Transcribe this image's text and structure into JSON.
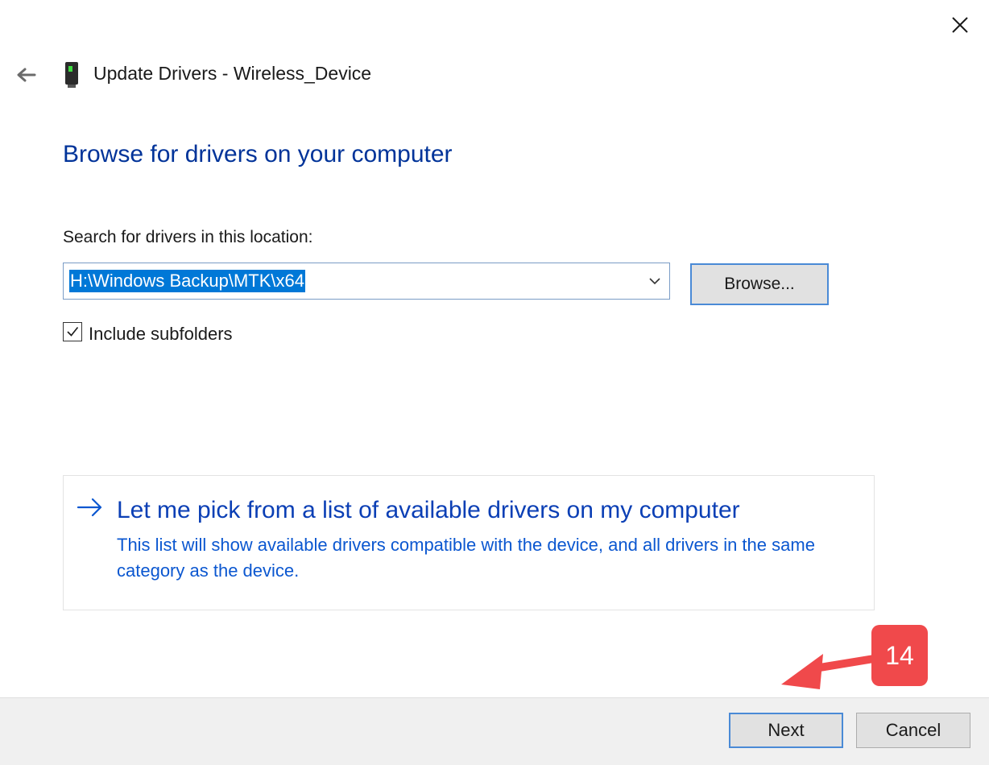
{
  "window": {
    "title": "Update Drivers - Wireless_Device",
    "close_icon": "close-icon",
    "back_icon": "back-arrow-icon",
    "device_icon": "wireless-device-icon"
  },
  "page": {
    "heading": "Browse for drivers on your computer",
    "search_label": "Search for drivers in this location:",
    "path_value": "H:\\Windows Backup\\MTK\\x64",
    "browse_label": "Browse...",
    "include_subfolders_label": "Include subfolders",
    "include_subfolders_checked": true
  },
  "pick_option": {
    "title": "Let me pick from a list of available drivers on my computer",
    "description": "This list will show available drivers compatible with the device, and all drivers in the same category as the device."
  },
  "footer": {
    "next_label": "Next",
    "cancel_label": "Cancel"
  },
  "annotation": {
    "step_number": "14",
    "badge_color": "#f0494b"
  },
  "colors": {
    "heading": "#003399",
    "link": "#0b57d0",
    "selection": "#0078d7"
  }
}
